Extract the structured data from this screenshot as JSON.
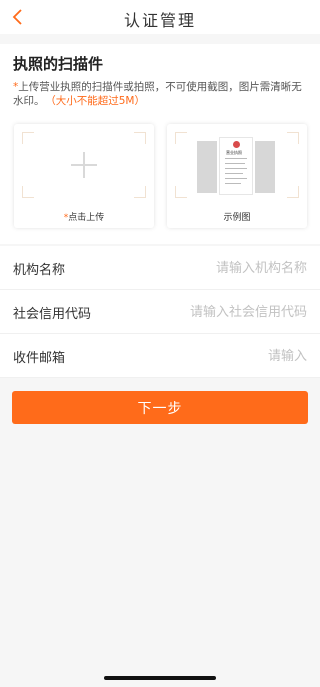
{
  "header": {
    "title": "认证管理",
    "back_icon": "chevron-left-icon",
    "accent": "#ff6b1a"
  },
  "upload": {
    "title": "执照的扫描件",
    "notice_star": "*",
    "notice_text": "上传营业执照的扫描件或拍照，不可使用截图，图片需清晰无水印。",
    "notice_limit": "（大小不能超过5M）",
    "upload_card": {
      "star": "*",
      "label": "点击上传",
      "icon": "plus-icon"
    },
    "example_card": {
      "label": "示例图",
      "sample_heading": "营业执照"
    }
  },
  "form": {
    "rows": [
      {
        "label": "机构名称",
        "placeholder": "请输入机构名称",
        "value": ""
      },
      {
        "label": "社会信用代码",
        "placeholder": "请输入社会信用代码",
        "value": ""
      },
      {
        "label": "收件邮箱",
        "placeholder": "请输入",
        "value": ""
      }
    ]
  },
  "actions": {
    "next_label": "下一步",
    "color": "#ff6b1a"
  }
}
